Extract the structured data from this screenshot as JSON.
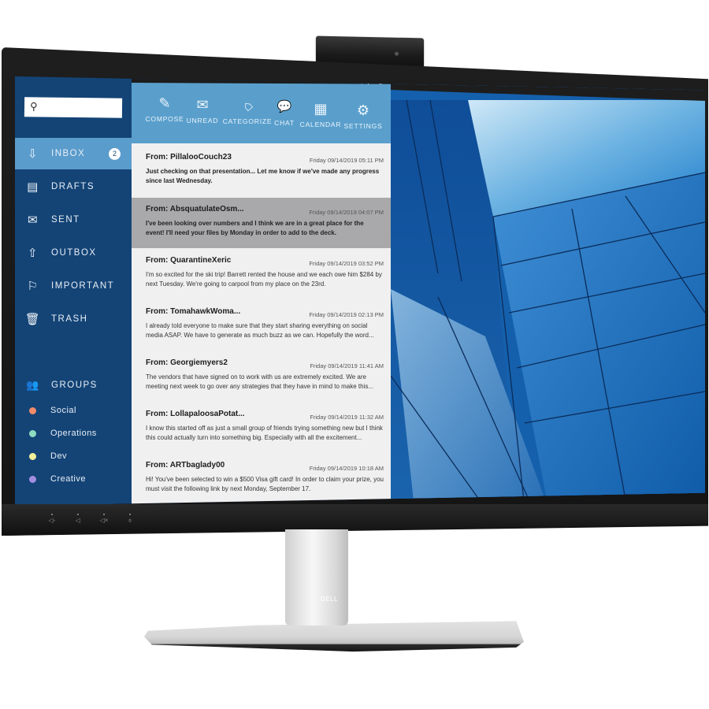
{
  "hardware": {
    "brand_logo": "DELL",
    "chin_buttons": [
      {
        "icon": "volume-down-icon",
        "glyph": "◁-"
      },
      {
        "icon": "volume-icon",
        "glyph": "◁"
      },
      {
        "icon": "mute-icon",
        "glyph": "◁×"
      },
      {
        "icon": "mic-mute-icon",
        "glyph": "⌽"
      }
    ]
  },
  "mail_window": {
    "controls": {
      "minimize": "–",
      "restore": "❐",
      "close": "✕"
    },
    "search": {
      "placeholder": "",
      "value": "",
      "icon": "search-icon"
    },
    "nav": [
      {
        "id": "inbox",
        "label": "INBOX",
        "icon": "inbox-icon",
        "glyph": "⇩",
        "badge": "2",
        "active": true
      },
      {
        "id": "drafts",
        "label": "DRAFTS",
        "icon": "drafts-icon",
        "glyph": "▤"
      },
      {
        "id": "sent",
        "label": "SENT",
        "icon": "sent-icon",
        "glyph": "✉"
      },
      {
        "id": "outbox",
        "label": "OUTBOX",
        "icon": "outbox-icon",
        "glyph": "⇧"
      },
      {
        "id": "important",
        "label": "IMPORTANT",
        "icon": "flag-icon",
        "glyph": "⚐"
      },
      {
        "id": "trash",
        "label": "TRASH",
        "icon": "trash-icon",
        "glyph": "🗑"
      }
    ],
    "groups": {
      "label": "GROUPS",
      "icon": "groups-icon",
      "glyph": "👥",
      "items": [
        {
          "label": "Social",
          "color": "#f08a6a"
        },
        {
          "label": "Operations",
          "color": "#8fdcc0"
        },
        {
          "label": "Dev",
          "color": "#f1ef9a"
        },
        {
          "label": "Creative",
          "color": "#a48ee0"
        }
      ]
    },
    "toolbar": [
      {
        "label": "COMPOSE",
        "icon": "pencil-icon",
        "glyph": "✎"
      },
      {
        "label": "UNREAD",
        "icon": "envelope-icon",
        "glyph": "✉"
      },
      {
        "label": "CATEGORIZE",
        "icon": "tag-icon",
        "glyph": "⌂"
      },
      {
        "label": "CHAT",
        "icon": "chat-icon",
        "glyph": "💬"
      },
      {
        "label": "CALENDAR",
        "icon": "calendar-icon",
        "glyph": "▦"
      },
      {
        "label": "SETTINGS",
        "icon": "gear-icon",
        "glyph": "⚙"
      }
    ],
    "emails": [
      {
        "from": "From: PillalooCouch23",
        "date": "Friday 09/14/2019 05:11 PM",
        "preview": "Just checking on that presentation... Let me know if we've made any progress since last Wednesday."
      },
      {
        "from": "From: AbsquatulateOsm...",
        "date": "Friday 09/14/2019 04:07 PM",
        "preview": "I've been looking over numbers and I think we are in a great place for the event! I'll need your files by Monday in order to add to the deck.",
        "selected": true
      },
      {
        "from": "From: QuarantineXeric",
        "date": "Friday 09/14/2019 03:52 PM",
        "preview": "I'm so excited for the ski trip! Barrett rented the house and we each owe him $284 by next Tuesday. We're going to carpool from my place on the 23rd."
      },
      {
        "from": "From: TomahawkWoma...",
        "date": "Friday 09/14/2019 02:13 PM",
        "preview": "I already told everyone to make sure that they start sharing everything on social media ASAP. We have to generate as much buzz as we can. Hopefully the word..."
      },
      {
        "from": "From: Georgiemyers2",
        "date": "Friday 09/14/2019 11:41 AM",
        "preview": "The vendors that have signed on to work with us are extremely excited. We are meeting next week to go over any strategies that they have in mind to make this..."
      },
      {
        "from": "From: LollapaloosaPotat...",
        "date": "Friday 09/14/2019 11:32 AM",
        "preview": "I know this started off as just a small group of friends trying something new but I think this could actually turn into something big. Especially with all the excitement..."
      },
      {
        "from": "From: ARTbaglady00",
        "date": "Friday 09/14/2019 10:18 AM",
        "preview": "Hi! You've been selected to win a $500 Visa gift card! In order to claim your prize, you must visit the following link by next Monday, September 17."
      }
    ]
  },
  "desktop_window": {
    "controls": {
      "minimize": "–",
      "restore": "❐",
      "close": "✕"
    },
    "wallpaper": "blue-glass-building"
  },
  "colors": {
    "sidebar": "#144476",
    "sidebar_active": "#5a9ccc",
    "toolbar": "#5a9fcc",
    "list_bg": "#f0f0f1",
    "selected_row": "#a9a9ab"
  }
}
